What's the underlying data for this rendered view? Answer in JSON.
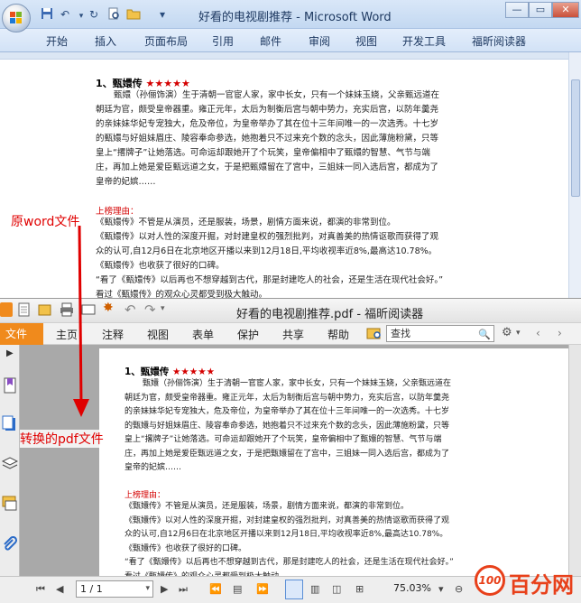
{
  "word": {
    "title": "好看的电视剧推荐 - Microsoft Word",
    "tabs": [
      "开始",
      "插入",
      "页面布局",
      "引用",
      "邮件",
      "审阅",
      "视图",
      "开发工具",
      "福昕阅读器"
    ]
  },
  "document": {
    "heading": "1、甄嬛传",
    "stars": "★★★★★",
    "body_lines": [
      "甄嬛（孙俪饰演）生于清朝一官宦人家，家中长女，只有一个妹妹玉娆，父亲甄远道在",
      "朝廷为官，颇受皇帝器重。雍正元年，太后为制衡后宫与朝中势力，充实后宫，以防年羹尧",
      "的亲妹妹华妃专宠独大，危及帝位，为皇帝举办了其在位十三年间唯一的一次选秀。十七岁",
      "的甄嬛与好姐妹眉庄、陵容奉命参选，她抱着只不过来充个数的念头，因此薄施粉黛，只等",
      "皇上“撂牌子”让她落选。可命运却跟她开了个玩笑，皇帝偏相中了甄嬛的智慧、气节与端",
      "庄，再加上她是爱臣甄远道之女，于是把甄嬛留在了宫中，三姐妹一同入选后宫，都成为了",
      "皇帝的妃嫔……"
    ],
    "reason_label": "上榜理由：",
    "reason_lines": [
      "《甄嬛传》不管是从演员，还是服装，场景，剧情方面来说，都演的非常到位。",
      "《甄嬛传》以对人性的深度开掘，对封建皇权的强烈批判，对真善美的热情讴歌而获得了观",
      "众的认可,自12月6日在北京地区开播以来到12月18日,平均收视率近8%,最高达10.78%。",
      "《甄嬛传》也收获了很好的口碑。",
      "“看了《甄嬛传》以后再也不想穿越到古代，那是封建吃人的社会，还是生活在现代社会好。”",
      "看过《甄嬛传》的观众心灵都受到极大触动。"
    ]
  },
  "annotations": {
    "word_label": "原word文件",
    "pdf_label": "转换的pdf文件"
  },
  "foxit": {
    "title": "好看的电视剧推荐.pdf - 福昕阅读器",
    "file_tab": "文件",
    "tabs": [
      "主页",
      "注释",
      "视图",
      "表单",
      "保护",
      "共享",
      "帮助"
    ],
    "search_placeholder": "查找",
    "page_indicator": "1 / 1",
    "zoom": "75.03%"
  },
  "watermark": {
    "number": "100",
    "text": "百分网"
  },
  "colors": {
    "accent_red": "#d40000",
    "foxit_orange": "#f08a1c",
    "word_blue": "#c3d8f1"
  }
}
